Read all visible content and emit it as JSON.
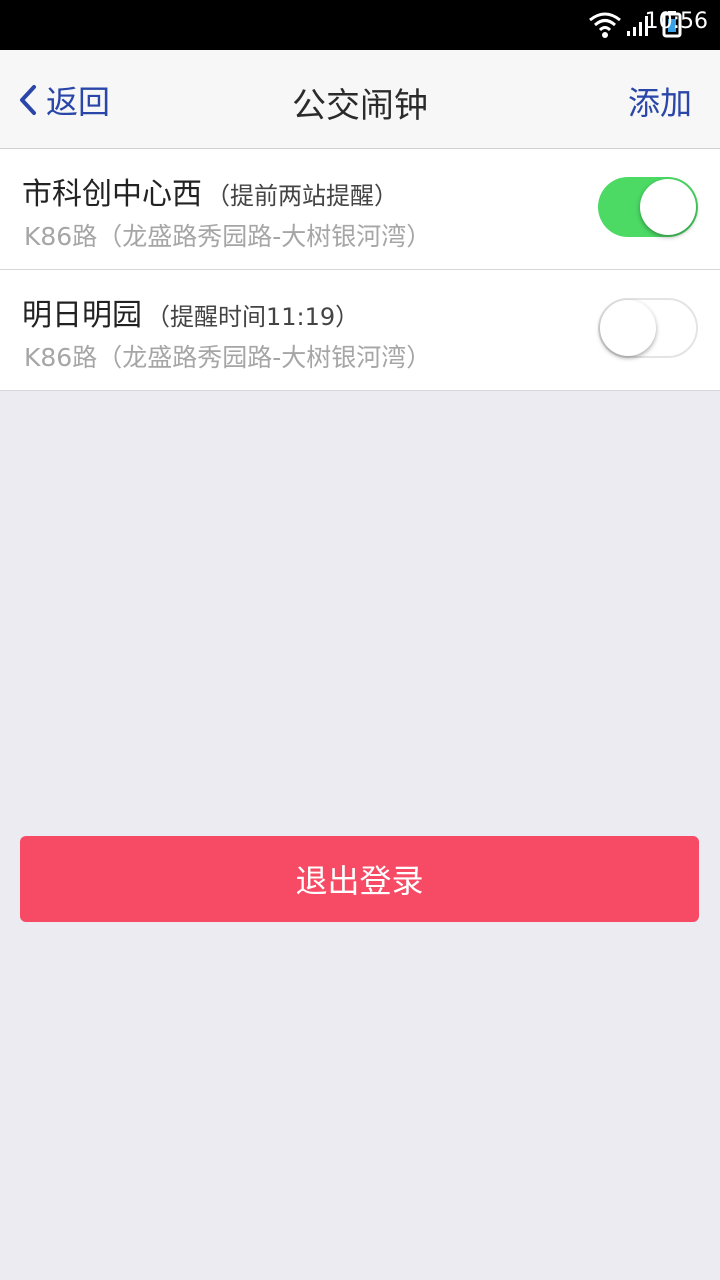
{
  "status_bar": {
    "time": "10:56",
    "icons": [
      "wifi-icon",
      "signal-icon",
      "battery-icon"
    ]
  },
  "nav": {
    "back_label": "返回",
    "title": "公交闹钟",
    "add_label": "添加"
  },
  "alarms": [
    {
      "station": "市科创中心西",
      "note": "（提前两站提醒）",
      "route": "K86路（龙盛路秀园路-大树银河湾）",
      "enabled": true
    },
    {
      "station": "明日明园",
      "note": "（提醒时间11:19）",
      "route": "K86路（龙盛路秀园路-大树银河湾）",
      "enabled": false
    }
  ],
  "logout_label": "退出登录",
  "colors": {
    "accent": "#2946a8",
    "toggle_on": "#4cd964",
    "logout": "#f64a65",
    "background": "#ecebf2"
  }
}
